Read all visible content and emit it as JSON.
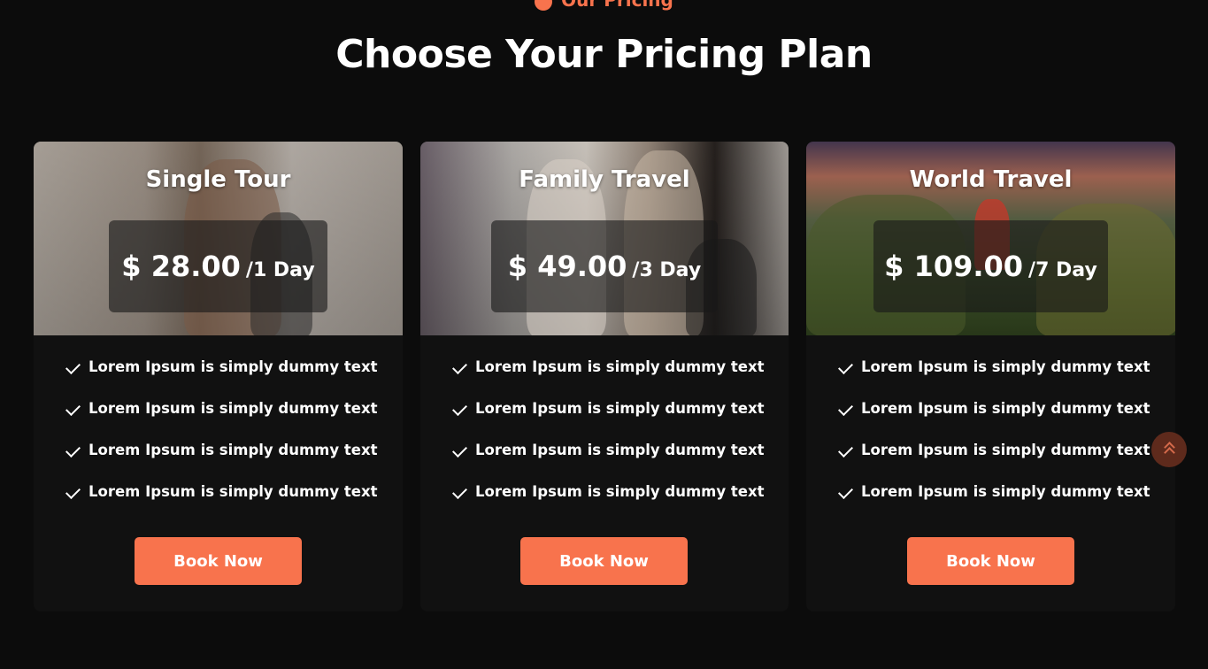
{
  "section": {
    "eyebrow": "Our Pricing",
    "title": "Choose Your Pricing Plan"
  },
  "plans": [
    {
      "name": "Single Tour",
      "price": "$ 28.00",
      "period": "/1 Day",
      "features": [
        "Lorem Ipsum is simply dummy text",
        "Lorem Ipsum is simply dummy text",
        "Lorem Ipsum is simply dummy text",
        "Lorem Ipsum is simply dummy text"
      ],
      "button": "Book Now"
    },
    {
      "name": "Family Travel",
      "price": "$ 49.00",
      "period": "/3 Day",
      "features": [
        "Lorem Ipsum is simply dummy text",
        "Lorem Ipsum is simply dummy text",
        "Lorem Ipsum is simply dummy text",
        "Lorem Ipsum is simply dummy text"
      ],
      "button": "Book Now"
    },
    {
      "name": "World Travel",
      "price": "$ 109.00",
      "period": "/7 Day",
      "features": [
        "Lorem Ipsum is simply dummy text",
        "Lorem Ipsum is simply dummy text",
        "Lorem Ipsum is simply dummy text",
        "Lorem Ipsum is simply dummy text"
      ],
      "button": "Book Now"
    }
  ],
  "icons": {
    "feature": "checkmark-icon",
    "eyebrow": "globe-icon",
    "scroll_top": "double-chevron-up-icon"
  },
  "colors": {
    "accent": "#f8734d",
    "background": "#0c0c0c",
    "card": "#111111"
  }
}
